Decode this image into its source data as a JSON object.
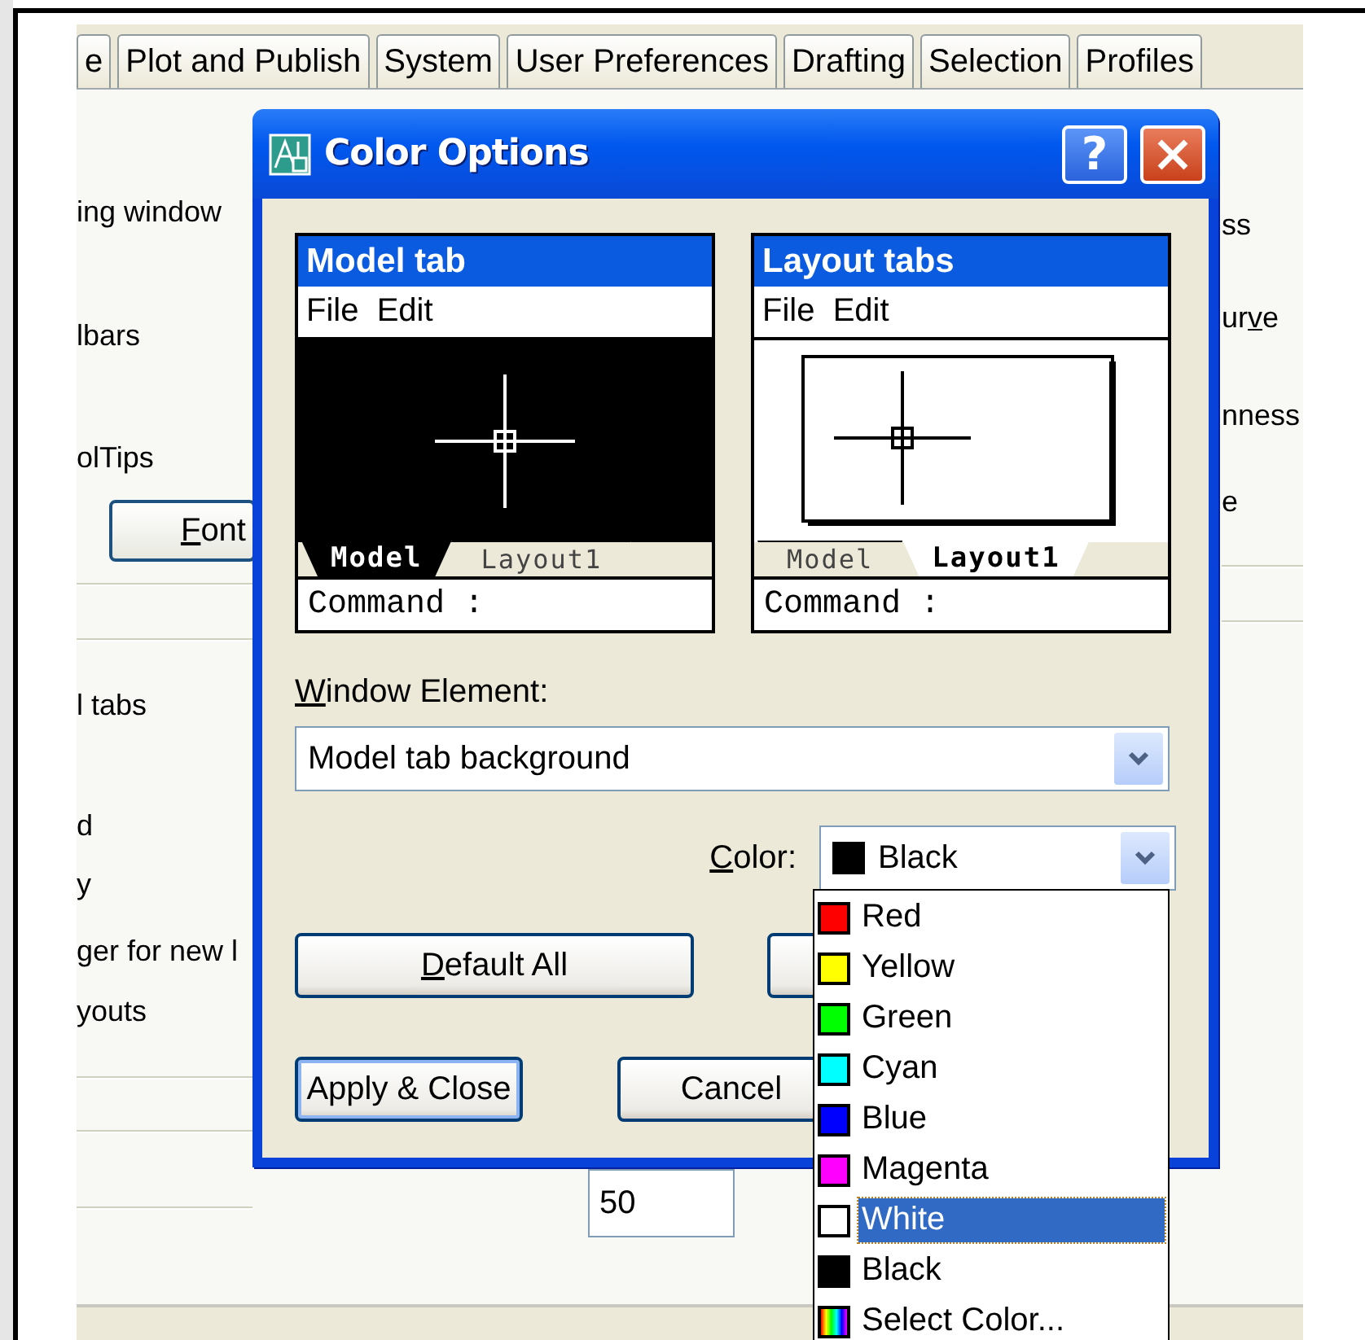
{
  "options_window": {
    "tabs": [
      {
        "label": "e",
        "selected": false
      },
      {
        "label": "Plot and Publish",
        "selected": false
      },
      {
        "label": "System",
        "selected": false
      },
      {
        "label": "User Preferences",
        "selected": false
      },
      {
        "label": "Drafting",
        "selected": false
      },
      {
        "label": "Selection",
        "selected": false
      },
      {
        "label": "Profiles",
        "selected": false
      }
    ],
    "left_labels": [
      "ing window",
      "lbars",
      "olTips",
      "l tabs",
      "d",
      "y",
      "ger for new l",
      "youts"
    ],
    "font_button": {
      "label": "Font"
    },
    "right_labels": [
      {
        "text": "ss"
      },
      {
        "text": "urve"
      },
      {
        "text": "nness"
      },
      {
        "text": "e"
      }
    ],
    "field_value": "50"
  },
  "dialog": {
    "title": "Color Options",
    "help": "?",
    "previews": [
      {
        "kind": "model",
        "title": "Model tab",
        "menu": "File  Edit",
        "tabs": [
          {
            "label": "Model",
            "selected": true
          },
          {
            "label": "Layout1",
            "selected": false
          }
        ],
        "command": "Command :"
      },
      {
        "kind": "layout",
        "title": "Layout tabs",
        "menu": "File  Edit",
        "tabs": [
          {
            "label": "Model",
            "selected": false
          },
          {
            "label": "Layout1",
            "selected": true
          }
        ],
        "command": "Command :"
      }
    ],
    "window_element_label": {
      "text": "Window Element:"
    },
    "window_element_value": "Model tab background",
    "color_label": {
      "text": "Color:"
    },
    "color_value": {
      "name": "Black",
      "color": "#000000"
    },
    "color_options": [
      {
        "kind": "swatch",
        "name": "Red",
        "color": "#ff0000",
        "selected": false
      },
      {
        "kind": "swatch",
        "name": "Yellow",
        "color": "#ffff00",
        "selected": false
      },
      {
        "kind": "swatch",
        "name": "Green",
        "color": "#00ff00",
        "selected": false
      },
      {
        "kind": "swatch",
        "name": "Cyan",
        "color": "#00ffff",
        "selected": false
      },
      {
        "kind": "swatch",
        "name": "Blue",
        "color": "#0000ff",
        "selected": false
      },
      {
        "kind": "swatch",
        "name": "Magenta",
        "color": "#ff00ff",
        "selected": false
      },
      {
        "kind": "swatch",
        "name": "White",
        "color": "#ffffff",
        "selected": true
      },
      {
        "kind": "swatch",
        "name": "Black",
        "color": "#000000",
        "selected": false
      },
      {
        "kind": "picker",
        "name": "Select Color...",
        "selected": false
      }
    ],
    "buttons": [
      {
        "label": "Default All",
        "default": false
      },
      {
        "label": "Apply & Close",
        "default": true
      },
      {
        "label": "Cancel",
        "default": false
      }
    ]
  }
}
